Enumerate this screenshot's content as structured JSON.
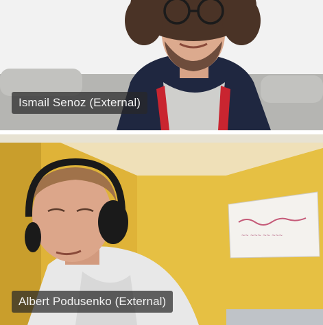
{
  "participants": [
    {
      "name": "Ismail Senoz (External)"
    },
    {
      "name": "Albert Podusenko (External)"
    }
  ],
  "whiteboard": {
    "text": "~~ ~~~ ~~ ~~~"
  },
  "colors": {
    "label_bg": "#282828",
    "label_text": "#f2f2f2",
    "wall_top": "#efefef",
    "wall_bottom": "#e3b93a"
  }
}
